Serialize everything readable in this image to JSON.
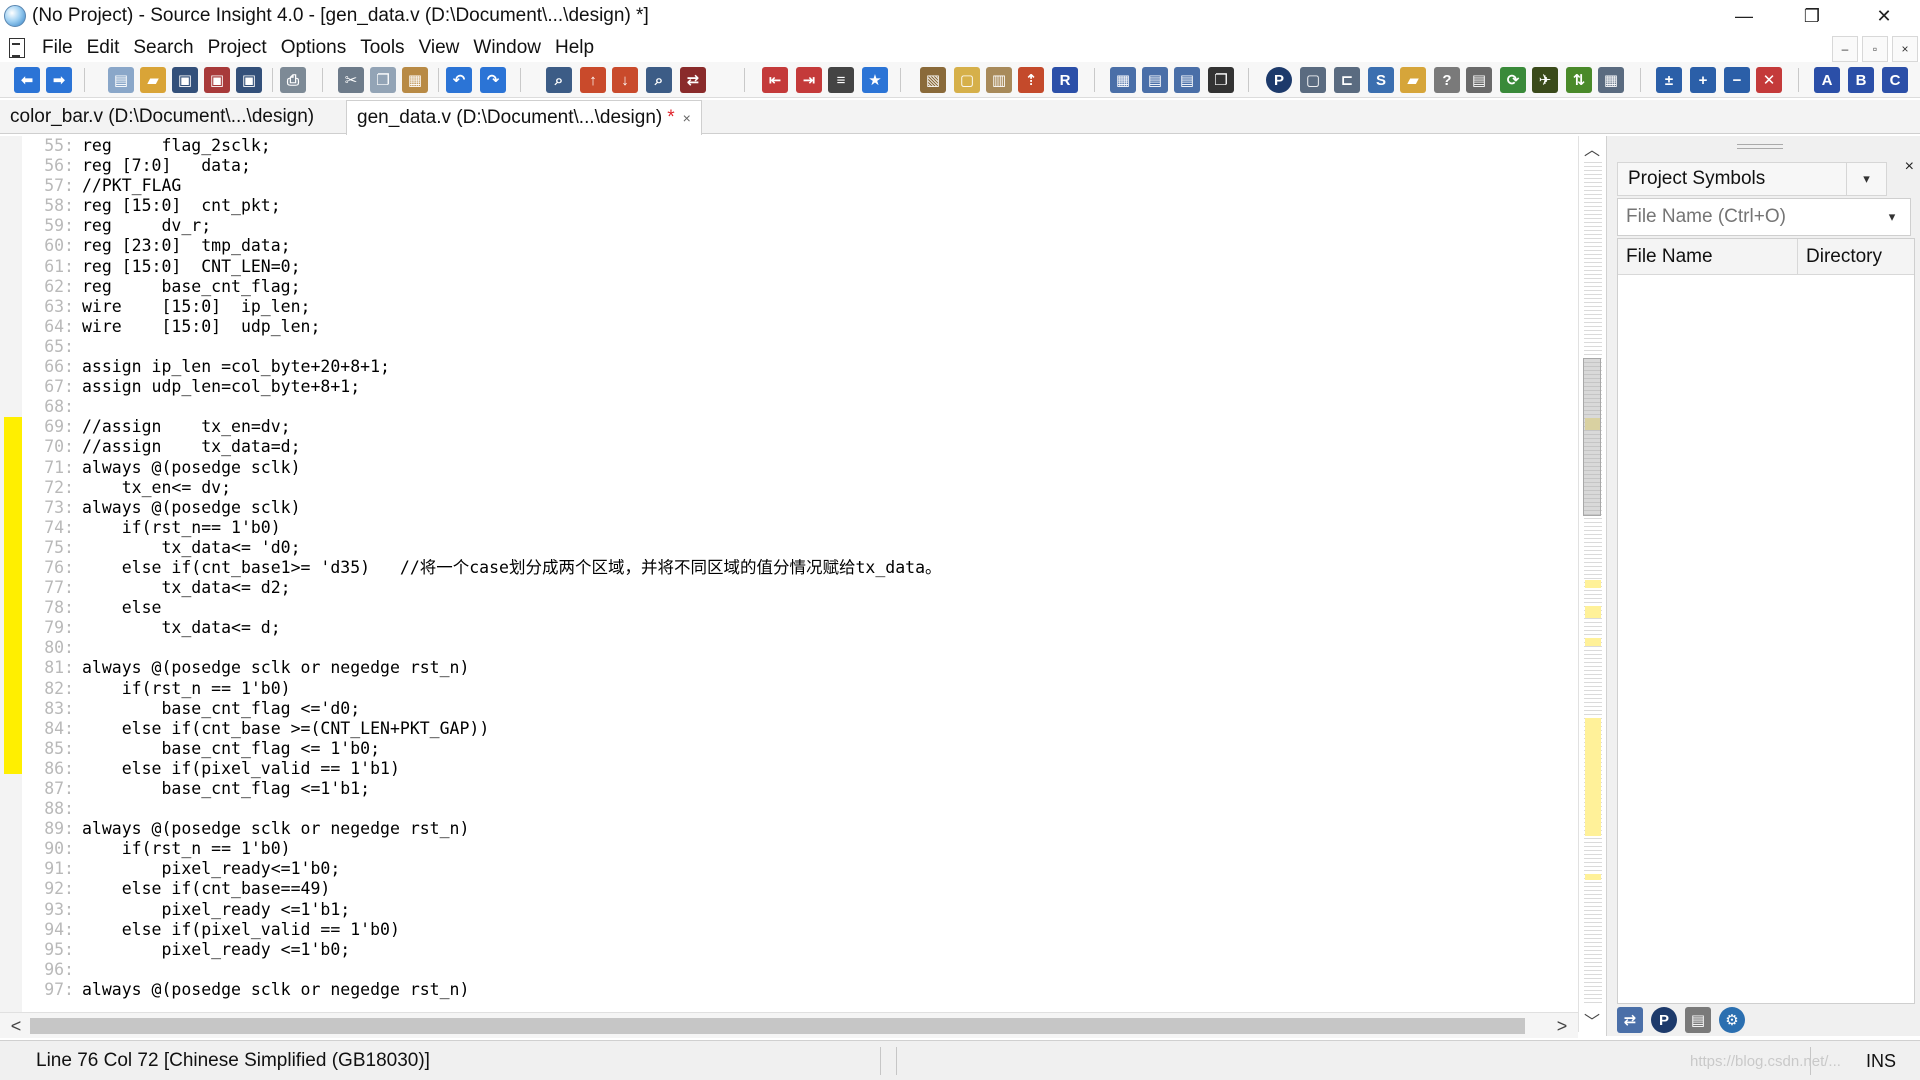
{
  "window": {
    "title": "(No Project) - Source Insight 4.0 - [gen_data.v (D:\\Document\\...\\design) *]",
    "minimize_glyph": "—",
    "restore_glyph": "❐",
    "close_glyph": "✕"
  },
  "menu": {
    "items": [
      "File",
      "Edit",
      "Search",
      "Project",
      "Options",
      "Tools",
      "View",
      "Window",
      "Help"
    ],
    "mdi_minimize": "–",
    "mdi_restore": "▫",
    "mdi_close": "×"
  },
  "tabs": [
    {
      "label": "color_bar.v (D:\\Document\\...\\design)",
      "active": false
    },
    {
      "label": "gen_data.v (D:\\Document\\...\\design)",
      "active": true,
      "modified_mark": "*",
      "close_glyph": "×"
    }
  ],
  "editor": {
    "lines": [
      {
        "n": "55:",
        "code": "reg     flag_2sclk;"
      },
      {
        "n": "56:",
        "code": "reg [7:0]   data;"
      },
      {
        "n": "57:",
        "code": "//PKT_FLAG"
      },
      {
        "n": "58:",
        "code": "reg [15:0]  cnt_pkt;"
      },
      {
        "n": "59:",
        "code": "reg     dv_r;"
      },
      {
        "n": "60:",
        "code": "reg [23:0]  tmp_data;"
      },
      {
        "n": "61:",
        "code": "reg [15:0]  CNT_LEN=0;"
      },
      {
        "n": "62:",
        "code": "reg     base_cnt_flag;"
      },
      {
        "n": "63:",
        "code": "wire    [15:0]  ip_len;"
      },
      {
        "n": "64:",
        "code": "wire    [15:0]  udp_len;"
      },
      {
        "n": "65:",
        "code": ""
      },
      {
        "n": "66:",
        "code": "assign ip_len =col_byte+20+8+1;"
      },
      {
        "n": "67:",
        "code": "assign udp_len=col_byte+8+1;"
      },
      {
        "n": "68:",
        "code": ""
      },
      {
        "n": "69:",
        "code": "//assign    tx_en=dv;"
      },
      {
        "n": "70:",
        "code": "//assign    tx_data=d;"
      },
      {
        "n": "71:",
        "code": "always @(posedge sclk)"
      },
      {
        "n": "72:",
        "code": "    tx_en<= dv;"
      },
      {
        "n": "73:",
        "code": "always @(posedge sclk)"
      },
      {
        "n": "74:",
        "code": "    if(rst_n== 1'b0)"
      },
      {
        "n": "75:",
        "code": "        tx_data<= 'd0;"
      },
      {
        "n": "76:",
        "code": "    else if(cnt_base1>= 'd35)   //将一个case划分成两个区域，并将不同区域的值分情况赋给tx_data。"
      },
      {
        "n": "77:",
        "code": "        tx_data<= d2;"
      },
      {
        "n": "78:",
        "code": "    else"
      },
      {
        "n": "79:",
        "code": "        tx_data<= d;"
      },
      {
        "n": "80:",
        "code": ""
      },
      {
        "n": "81:",
        "code": "always @(posedge sclk or negedge rst_n)"
      },
      {
        "n": "82:",
        "code": "    if(rst_n == 1'b0)"
      },
      {
        "n": "83:",
        "code": "        base_cnt_flag <='d0;"
      },
      {
        "n": "84:",
        "code": "    else if(cnt_base >=(CNT_LEN+PKT_GAP))"
      },
      {
        "n": "85:",
        "code": "        base_cnt_flag <= 1'b0;"
      },
      {
        "n": "86:",
        "code": "    else if(pixel_valid == 1'b1)"
      },
      {
        "n": "87:",
        "code": "        base_cnt_flag <=1'b1;"
      },
      {
        "n": "88:",
        "code": ""
      },
      {
        "n": "89:",
        "code": "always @(posedge sclk or negedge rst_n)"
      },
      {
        "n": "90:",
        "code": "    if(rst_n == 1'b0)"
      },
      {
        "n": "91:",
        "code": "        pixel_ready<=1'b0;"
      },
      {
        "n": "92:",
        "code": "    else if(cnt_base==49)"
      },
      {
        "n": "93:",
        "code": "        pixel_ready <=1'b1;"
      },
      {
        "n": "94:",
        "code": "    else if(pixel_valid == 1'b0)"
      },
      {
        "n": "95:",
        "code": "        pixel_ready <=1'b0;"
      },
      {
        "n": "96:",
        "code": ""
      },
      {
        "n": "97:",
        "code": "always @(posedge sclk or negedge rst_n)"
      }
    ],
    "changed_lines": [
      "69",
      "79"
    ]
  },
  "scrollbars": {
    "up_arrow": "︿",
    "down_arrow": "﹀",
    "left_arrow": "<",
    "right_arrow": ">"
  },
  "symbol_panel": {
    "title": "Project Symbols",
    "dropdown_glyph": "▾",
    "close_glyph": "×",
    "search_placeholder": "File Name (Ctrl+O)",
    "columns": [
      "File Name",
      "Directory"
    ]
  },
  "status": {
    "position": "Line 76  Col 72   [Chinese Simplified (GB18030)]",
    "mode": "INS",
    "watermark": "https://blog.csdn.net/..."
  },
  "colors": {
    "change_mark": "#ffef00",
    "modified_star": "#e0242c",
    "line_number": "#b9b9b9"
  }
}
